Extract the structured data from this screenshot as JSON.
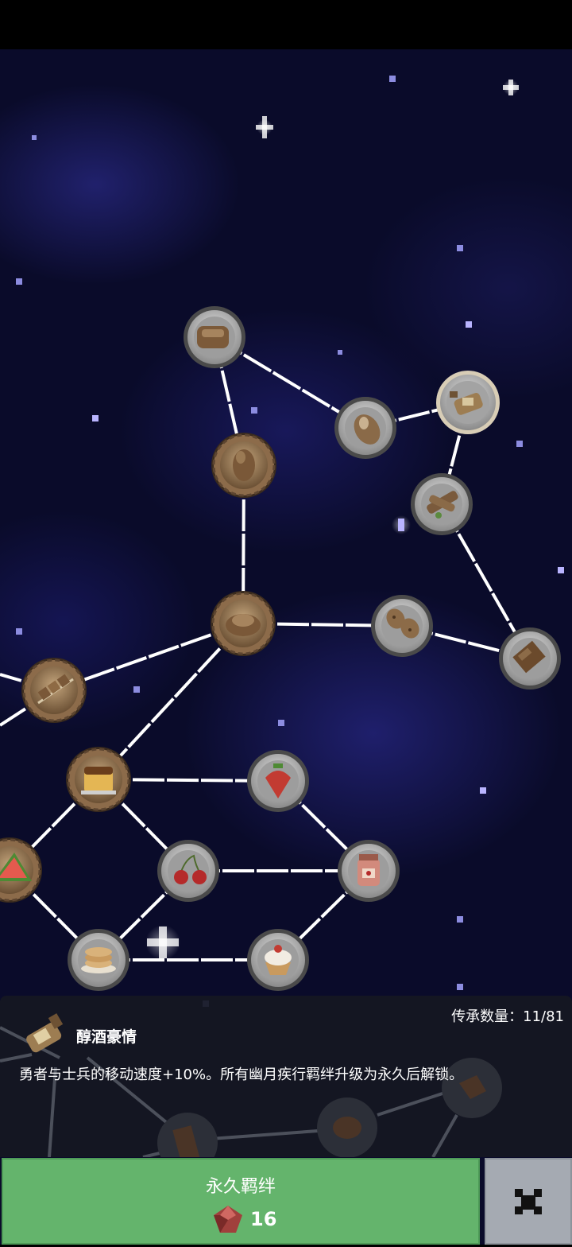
{
  "header": {
    "background": "#000000"
  },
  "constellation": {
    "star_colors": [
      "#ffffff",
      "#b9b4ff",
      "#8c8ce0"
    ],
    "nodes": [
      {
        "icon": "bread-loaf-icon",
        "style": "silver"
      },
      {
        "icon": "bread-roll-icon",
        "style": "silver"
      },
      {
        "icon": "liquor-bottle-icon",
        "style": "silver-highlight"
      },
      {
        "icon": "beef-jerky-icon",
        "style": "bronze"
      },
      {
        "icon": "sausage-icon",
        "style": "silver"
      },
      {
        "icon": "meat-bun-icon",
        "style": "bronze"
      },
      {
        "icon": "cookies-icon",
        "style": "silver"
      },
      {
        "icon": "brownie-icon",
        "style": "silver"
      },
      {
        "icon": "kebab-icon",
        "style": "bronze"
      },
      {
        "icon": "pudding-icon",
        "style": "bronze"
      },
      {
        "icon": "strawberry-icon",
        "style": "silver"
      },
      {
        "icon": "watermelon-icon",
        "style": "bronze"
      },
      {
        "icon": "cherries-icon",
        "style": "silver"
      },
      {
        "icon": "jam-jar-icon",
        "style": "silver"
      },
      {
        "icon": "pancakes-icon",
        "style": "silver"
      },
      {
        "icon": "cream-cake-icon",
        "style": "silver"
      }
    ]
  },
  "info": {
    "legacy_count_label": "传承数量：11/81",
    "skill_icon": "liquor-bottle-icon",
    "skill_title": "醇酒豪情",
    "skill_description": "勇者与士兵的移动速度+10%。所有幽月疾行羁绊升级为永久后解锁。"
  },
  "action": {
    "label": "永久羁绊",
    "cost_icon": "red-gem-icon",
    "cost_value": "16",
    "color": "#64b46c"
  },
  "close": {
    "icon": "close-icon",
    "color": "#a5aab2"
  }
}
